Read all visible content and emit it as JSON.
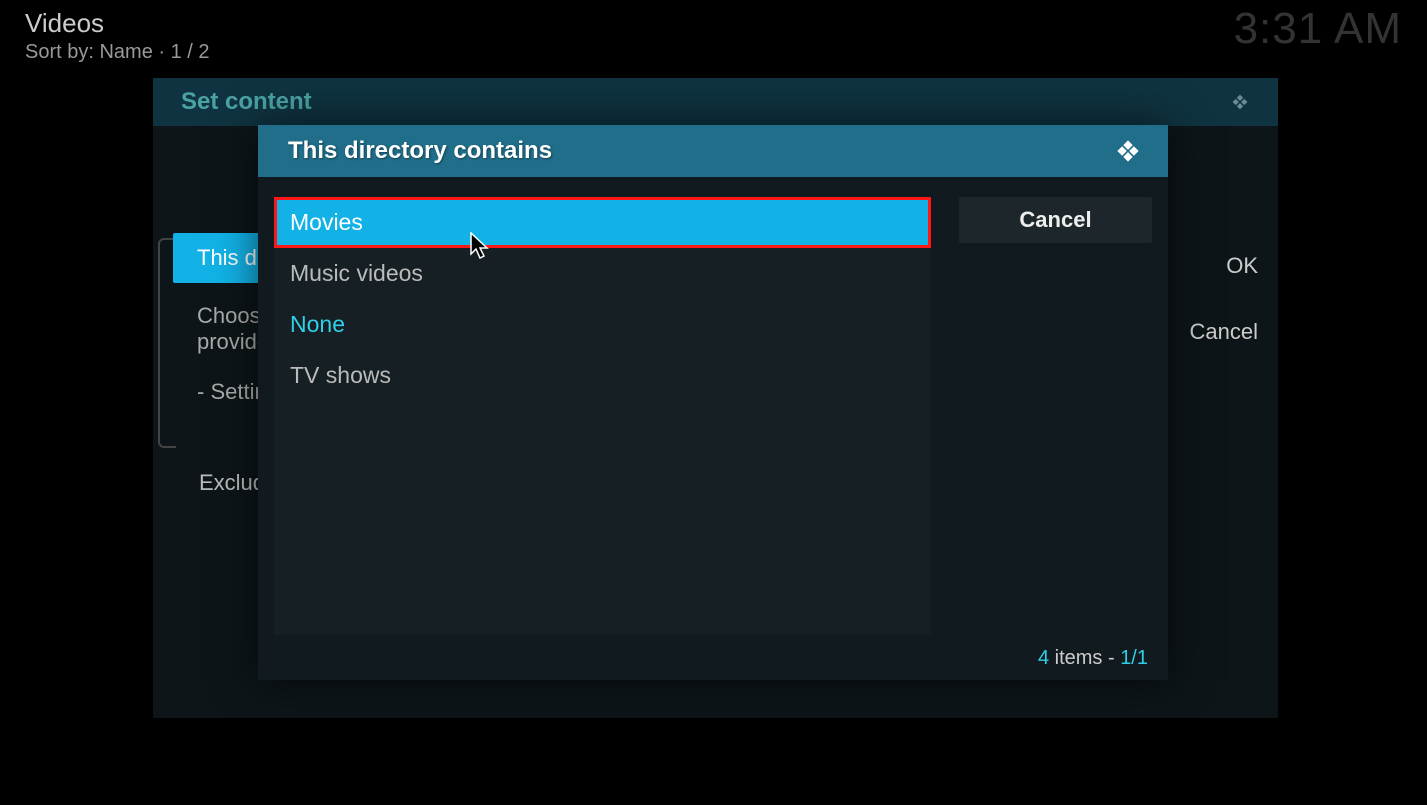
{
  "top": {
    "title": "Videos",
    "sort": "Sort by: Name  ·  1 / 2",
    "clock": "3:31 AM"
  },
  "outer": {
    "title": "Set content",
    "tab_active": "This directory contains",
    "tab_choose": "Choose information provider",
    "tab_settings": "- Settings",
    "exclude": "Exclude path from library updates",
    "btn_ok": "OK",
    "btn_cancel": "Cancel"
  },
  "inner": {
    "title": "This directory contains",
    "items": {
      "movies": "Movies",
      "music_videos": "Music videos",
      "none": "None",
      "tv_shows": "TV shows"
    },
    "cancel": "Cancel",
    "footer_count": "4",
    "footer_label": " items - ",
    "footer_page": "1/1"
  }
}
